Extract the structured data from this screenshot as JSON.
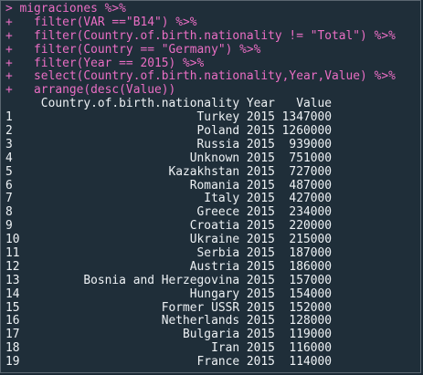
{
  "colors": {
    "background": "#1f2e39",
    "command_text": "#ea6ec4",
    "output_text": "#eef2f5",
    "border": "#5a6670"
  },
  "console": {
    "command_lines": [
      "> migraciones %>%",
      "+   filter(VAR ==\"B14\") %>%",
      "+   filter(Country.of.birth.nationality != \"Total\") %>%",
      "+   filter(Country == \"Germany\") %>%",
      "+   filter(Year == 2015) %>%",
      "+   select(Country.of.birth.nationality,Year,Value) %>%",
      "+   arrange(desc(Value))"
    ],
    "header_line": "     Country.of.birth.nationality Year   Value",
    "output_lines": [
      "1                          Turkey 2015 1347000",
      "2                          Poland 2015 1260000",
      "3                          Russia 2015  939000",
      "4                         Unknown 2015  751000",
      "5                      Kazakhstan 2015  727000",
      "6                         Romania 2015  487000",
      "7                           Italy 2015  427000",
      "8                          Greece 2015  234000",
      "9                         Croatia 2015  220000",
      "10                        Ukraine 2015  215000",
      "11                         Serbia 2015  187000",
      "12                        Austria 2015  186000",
      "13         Bosnia and Herzegovina 2015  157000",
      "14                        Hungary 2015  154000",
      "15                    Former USSR 2015  152000",
      "16                    Netherlands 2015  128000",
      "17                       Bulgaria 2015  119000",
      "18                           Iran 2015  116000",
      "19                         France 2015  114000"
    ]
  }
}
